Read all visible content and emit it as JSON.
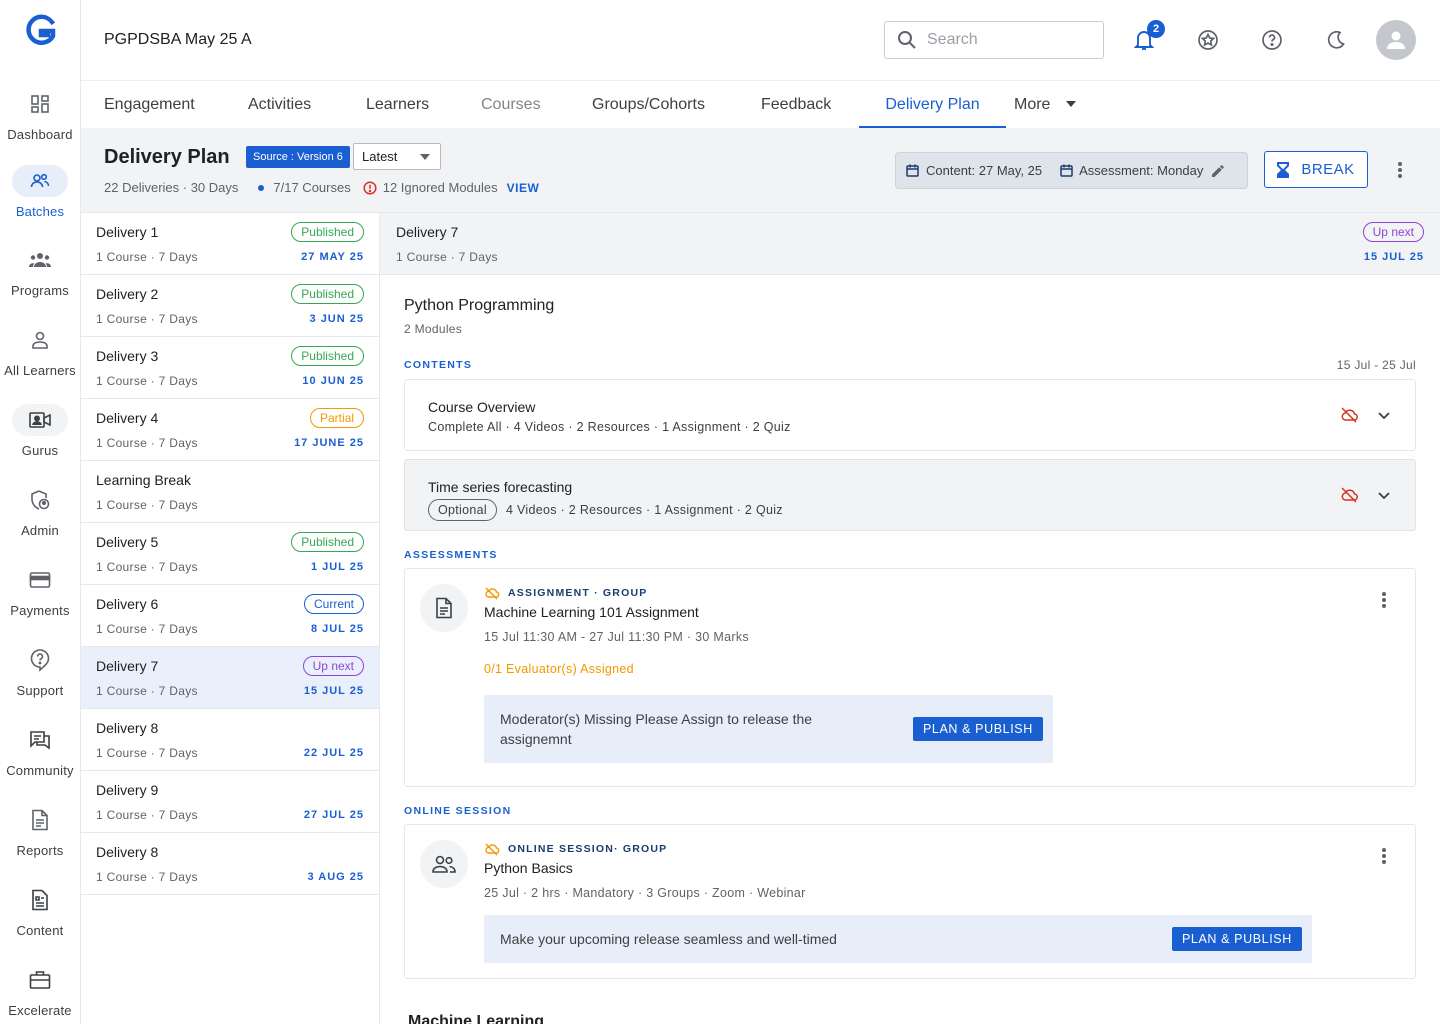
{
  "brand": {
    "accent": "#1a5fd1",
    "success": "#34a853",
    "warning": "#f29900",
    "upnext": "#8e44d8"
  },
  "sidebar": {
    "items": [
      {
        "label": "Dashboard",
        "icon": "dashboard-icon"
      },
      {
        "label": "Batches",
        "icon": "batches-icon",
        "active": true
      },
      {
        "label": "Programs",
        "icon": "programs-icon"
      },
      {
        "label": "All Learners",
        "icon": "learners-icon"
      },
      {
        "label": "Gurus",
        "icon": "gurus-icon"
      },
      {
        "label": "Admin",
        "icon": "admin-icon"
      },
      {
        "label": "Payments",
        "icon": "payments-icon"
      },
      {
        "label": "Support",
        "icon": "support-icon"
      },
      {
        "label": "Community",
        "icon": "community-icon"
      },
      {
        "label": "Reports",
        "icon": "reports-icon"
      },
      {
        "label": "Content",
        "icon": "content-icon"
      },
      {
        "label": "Excelerate",
        "icon": "excelerate-icon"
      }
    ]
  },
  "header": {
    "batch_title": "PGPDSBA May 25 A",
    "search_placeholder": "Search",
    "notification_count": "2"
  },
  "tabs": [
    {
      "label": "Engagement"
    },
    {
      "label": "Activities"
    },
    {
      "label": "Learners"
    },
    {
      "label": "Courses",
      "disabled": true
    },
    {
      "label": "Groups/Cohorts"
    },
    {
      "label": "Feedback"
    },
    {
      "label": "Delivery Plan",
      "active": true
    },
    {
      "label": "More"
    }
  ],
  "plan": {
    "title": "Delivery Plan",
    "source_chip": "Source : Version 6",
    "version_select": "Latest",
    "meta_counts": "22 Deliveries · 30 Days",
    "courses": "7/17 Courses",
    "ignored": "12 Ignored Modules",
    "view_link": "VIEW",
    "content_date": "Content: 27 May, 25",
    "assessment_day": "Assessment: Monday",
    "break_label": "BREAK"
  },
  "deliveries": [
    {
      "name": "Delivery 1",
      "sub": "1 Course · 7 Days",
      "status": "Published",
      "date": "27 MAY 25"
    },
    {
      "name": "Delivery 2",
      "sub": "1 Course · 7 Days",
      "status": "Published",
      "date": "3 JUN 25"
    },
    {
      "name": "Delivery 3",
      "sub": "1 Course · 7 Days",
      "status": "Published",
      "date": "10 JUN 25"
    },
    {
      "name": "Delivery 4",
      "sub": "1 Course · 7 Days",
      "status": "Partial",
      "date": "17 JUNE 25"
    },
    {
      "name": "Learning Break",
      "sub": "1 Course · 7 Days",
      "status": "",
      "date": ""
    },
    {
      "name": "Delivery 5",
      "sub": "1 Course · 7 Days",
      "status": "Published",
      "date": "1 JUL 25"
    },
    {
      "name": "Delivery 6",
      "sub": "1 Course · 7 Days",
      "status": "Current",
      "date": "8 JUL 25"
    },
    {
      "name": "Delivery 7",
      "sub": "1 Course · 7 Days",
      "status": "Up next",
      "date": "15 JUL 25"
    },
    {
      "name": "Delivery 8",
      "sub": "1 Course · 7 Days",
      "status": "",
      "date": "22 JUL 25"
    },
    {
      "name": "Delivery 9",
      "sub": "1 Course · 7 Days",
      "status": "",
      "date": "27 JUL 25"
    },
    {
      "name": "Delivery 8",
      "sub": "1 Course · 7 Days",
      "status": "",
      "date": "3 AUG 25"
    }
  ],
  "detail": {
    "name": "Delivery 7",
    "sub": "1 Course · 7 Days",
    "status": "Up next",
    "date": "15 JUL 25",
    "course_title": "Python Programming",
    "course_sub": "2 Modules",
    "contents_label": "CONTENTS",
    "date_range": "15 Jul - 25 Jul",
    "modules": [
      {
        "title": "Course Overview",
        "sub": "Complete All · 4 Videos  · 2 Resources · 1 Assignment · 2 Quiz"
      },
      {
        "title": "Time series forecasting",
        "chip": "Optional",
        "sub": "4 Videos  · 2 Resources · 1 Assignment · 2 Quiz"
      }
    ],
    "assessments_label": "ASSESSMENTS",
    "assessment": {
      "type": "ASSIGNMENT · GROUP",
      "title": "Machine Learning 101 Assignment",
      "sub": "15 Jul 11:30 AM - 27 Jul 11:30 PM · 30 Marks",
      "evaluators": "0/1 Evaluator(s) Assigned",
      "banner_line1": "Moderator(s) Missing Please Assign to release the",
      "banner_line2": "assignemnt",
      "button": "PLAN & PUBLISH"
    },
    "online_label": "ONLINE SESSION",
    "session": {
      "type": "ONLINE SESSION· GROUP",
      "title": "Python Basics",
      "sub": "25 Jul · 2 hrs · Mandatory · 3 Groups · Zoom · Webinar",
      "banner": "Make your upcoming release seamless and well-timed",
      "button": "PLAN & PUBLISH"
    },
    "next_course_title": "Machine Learning"
  }
}
